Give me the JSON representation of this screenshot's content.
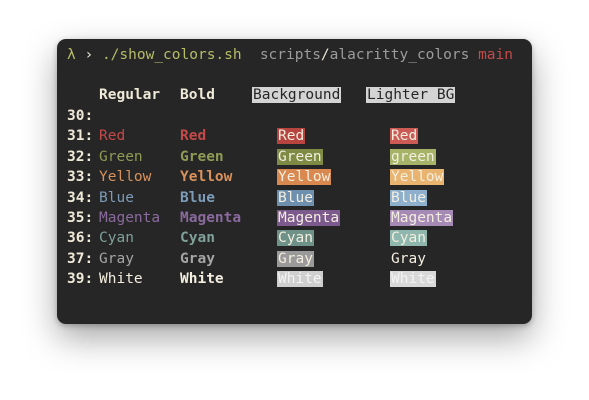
{
  "prompt": {
    "symbol": "λ",
    "arrow": "›",
    "command": "./show_colors.sh",
    "cwd_parent": "scripts",
    "cwd_sep": "/",
    "cwd_current": "alacritty_colors",
    "branch": "main"
  },
  "headers": {
    "regular": "Regular",
    "bold": "Bold",
    "background": "Background",
    "lighter_bg": "Lighter BG"
  },
  "rows": [
    {
      "num": "30:",
      "regular": "",
      "bold": "",
      "bg": "",
      "lbg": ""
    },
    {
      "num": "31:",
      "regular": "Red",
      "bold": "Red",
      "bg": "Red",
      "lbg": "Red"
    },
    {
      "num": "32:",
      "regular": "Green",
      "bold": "Green",
      "bg": "Green",
      "lbg": "green"
    },
    {
      "num": "33:",
      "regular": "Yellow",
      "bold": "Yellow",
      "bg": "Yellow",
      "lbg": "Yellow"
    },
    {
      "num": "34:",
      "regular": "Blue",
      "bold": "Blue",
      "bg": "Blue",
      "lbg": "Blue"
    },
    {
      "num": "35:",
      "regular": "Magenta",
      "bold": "Magenta",
      "bg": "Magenta",
      "lbg": "Magenta"
    },
    {
      "num": "36:",
      "regular": "Cyan",
      "bold": "Cyan",
      "bg": "Cyan",
      "lbg": "Cyan"
    },
    {
      "num": "37:",
      "regular": "Gray",
      "bold": "Gray",
      "bg": "Gray",
      "lbg": "Gray"
    },
    {
      "num": "39:",
      "regular": "White",
      "bold": "White",
      "bg": "White",
      "lbg": "White"
    }
  ],
  "colors": {
    "background": "#262626",
    "foreground": "#e8e3d5",
    "red": "#c44a4a",
    "green": "#8f9b55",
    "yellow": "#d9925c",
    "blue": "#7b9bb8",
    "magenta": "#8a6a9e",
    "cyan": "#7fa19a",
    "gray": "#a5a5a5",
    "white": "#f3eedf",
    "bg_red": "#b7443f",
    "bg_green": "#7e8b45",
    "bg_yellow": "#d9894f",
    "bg_blue": "#6e8fad",
    "bg_magenta": "#7c5a8e",
    "bg_cyan": "#6f9288",
    "bg_gray": "#9a9a9a",
    "bg_white": "#cfcfcf",
    "lbg_red": "#cc5a55",
    "lbg_green": "#a6b46a",
    "lbg_yellow": "#e8b470",
    "lbg_blue": "#8fb0cc",
    "lbg_magenta": "#a68ab6",
    "lbg_cyan": "#8fb7ad",
    "lbg_gray": "#262626",
    "lbg_white": "#d8d8d8"
  }
}
